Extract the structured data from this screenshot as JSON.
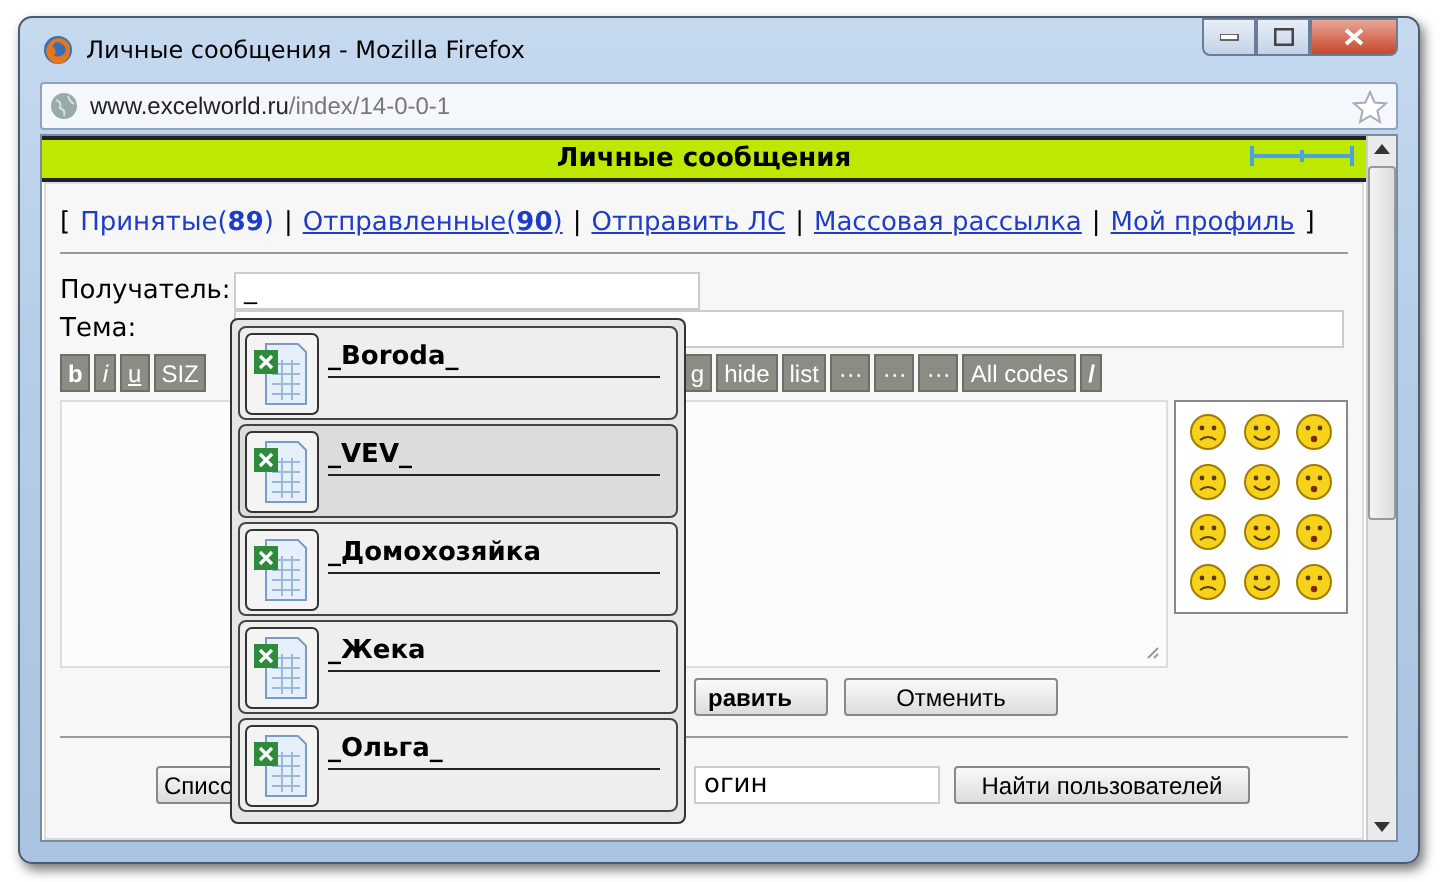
{
  "window": {
    "title": "Личные сообщения - Mozilla Firefox",
    "url_domain": "www.excelworld.ru",
    "url_path": "/index/14-0-0-1"
  },
  "header": {
    "title": "Личные сообщения"
  },
  "nav": {
    "open": "[",
    "close": "]",
    "items": [
      {
        "label": "Принятые(**89**)",
        "selected": true,
        "separator": "|"
      },
      {
        "label": "Отправленные(**90**)",
        "selected": false,
        "separator": "|"
      },
      {
        "label": "Отправить ЛС",
        "selected": false,
        "separator": "|"
      },
      {
        "label": "Массовая рассылка",
        "selected": false,
        "separator": "|"
      },
      {
        "label": "Мой профиль",
        "selected": false
      }
    ]
  },
  "form": {
    "recipient_label": "Получатель:",
    "recipient_value": "_",
    "subject_label": "Тема:"
  },
  "toolbar": {
    "left": [
      {
        "label": "b",
        "kind": "bold"
      },
      {
        "label": "i",
        "kind": "italic"
      },
      {
        "label": "u",
        "kind": "underline"
      },
      {
        "label": "SIZ",
        "kind": "plain"
      }
    ],
    "right": [
      {
        "label": "g",
        "kind": "plain"
      },
      {
        "label": "hide",
        "kind": "plain"
      },
      {
        "label": "list",
        "kind": "plain"
      },
      {
        "label": "···",
        "kind": "plain"
      },
      {
        "label": "···",
        "kind": "plain"
      },
      {
        "label": "···",
        "kind": "plain"
      },
      {
        "label": "All codes",
        "kind": "plain"
      },
      {
        "label": "/",
        "kind": "bold"
      }
    ]
  },
  "buttons": {
    "send": "равить",
    "cancel": "Отменить"
  },
  "search": {
    "list_button": "Списо",
    "login_value": "огин",
    "find_button": "Найти пользователей"
  },
  "suggestions": [
    {
      "name": "_Boroda_",
      "selected": false
    },
    {
      "name": "_VEV_",
      "selected": true
    },
    {
      "name": "_Домохозяйка",
      "selected": false
    },
    {
      "name": "_Жека",
      "selected": false
    },
    {
      "name": "_Ольга_",
      "selected": false
    }
  ]
}
